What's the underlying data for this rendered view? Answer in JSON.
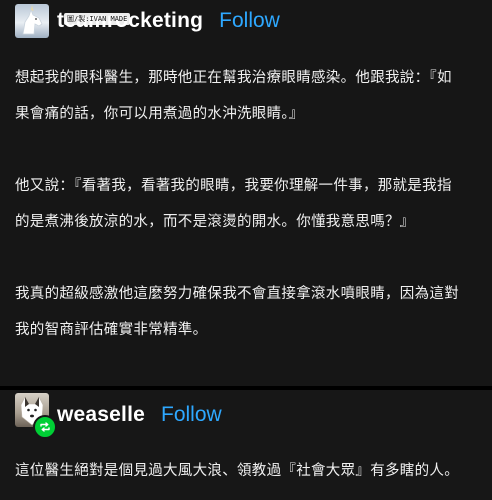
{
  "posts": [
    {
      "username": "teamrocketing",
      "follow_label": "Follow",
      "watermark": "圖/製:IVAN MADE",
      "avatar_icon": "unicorn-avatar-icon",
      "paragraphs": [
        [
          "想起我的眼科醫生，那時他正在幫我治療眼睛感染。他跟我說：『如",
          "果會痛的話，你可以用煮過的水沖洗眼睛。』"
        ],
        [
          "他又說：『看著我，看著我的眼睛，我要你理解一件事，那就是我指",
          "的是煮沸後放涼的水，而不是滾燙的開水。你懂我意思嗎？』"
        ],
        [
          "我真的超級感激他這麼努力確保我不會直接拿滾水噴眼睛，因為這對",
          "我的智商評估確實非常精準。"
        ]
      ]
    },
    {
      "username": "weaselle",
      "follow_label": "Follow",
      "avatar_icon": "dog-avatar-icon",
      "badge_icon": "reblog-icon",
      "paragraphs": [
        [
          "這位醫生絕對是個見過大風大浪、領教過『社會大眾』有多瞎的人。"
        ]
      ]
    }
  ],
  "colors": {
    "follow": "#2ea8ff",
    "reblog_badge": "#00cf35",
    "background": "#161616"
  }
}
